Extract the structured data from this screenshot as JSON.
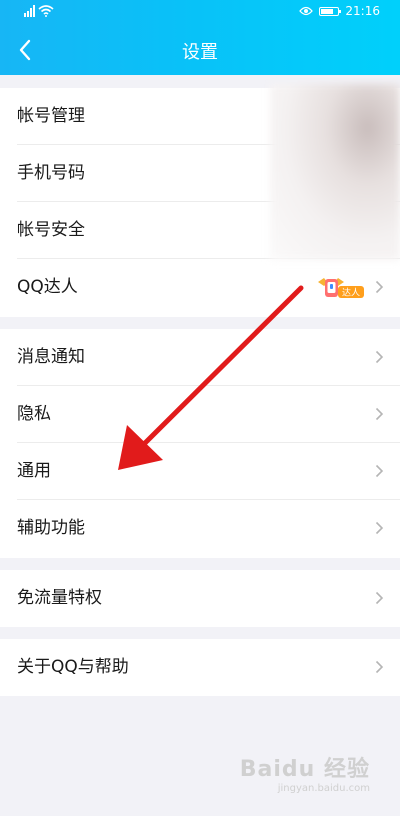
{
  "status_bar": {
    "time": "21:16"
  },
  "header": {
    "title": "设置"
  },
  "groups": [
    {
      "items": [
        {
          "label": "帐号管理"
        },
        {
          "label": "手机号码"
        },
        {
          "label": "帐号安全"
        },
        {
          "label": "QQ达人",
          "badge_text": "达人"
        }
      ]
    },
    {
      "items": [
        {
          "label": "消息通知"
        },
        {
          "label": "隐私"
        },
        {
          "label": "通用"
        },
        {
          "label": "辅助功能"
        }
      ]
    },
    {
      "items": [
        {
          "label": "免流量特权"
        }
      ]
    },
    {
      "items": [
        {
          "label": "关于QQ与帮助"
        }
      ]
    }
  ],
  "watermark": {
    "text": "Baidu 经验",
    "sub": "jingyan.baidu.com"
  },
  "colors": {
    "header_start": "#17b6f5",
    "header_end": "#00d0fb",
    "arrow": "#e11b1b",
    "background": "#f2f2f7"
  }
}
